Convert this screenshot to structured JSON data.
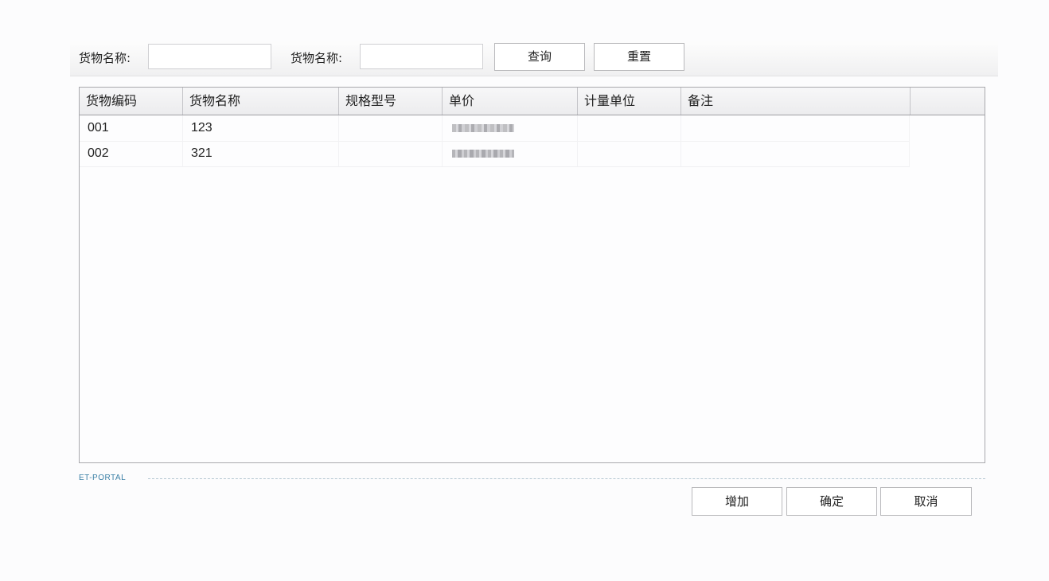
{
  "search": {
    "label1": "货物名称:",
    "label2": "货物名称:",
    "input1_value": "",
    "input2_value": "",
    "query_button": "查询",
    "reset_button": "重置"
  },
  "grid": {
    "columns": [
      "货物编码",
      "货物名称",
      "规格型号",
      "单价",
      "计量单位",
      "备注",
      ""
    ],
    "rows": [
      {
        "code": "001",
        "name": "123",
        "spec": "",
        "price": "",
        "unit": "",
        "note": ""
      },
      {
        "code": "002",
        "name": "321",
        "spec": "",
        "price": "",
        "unit": "",
        "note": ""
      }
    ]
  },
  "footer": {
    "brand": "ET-PORTAL",
    "add_button": "增加",
    "confirm_button": "确定",
    "cancel_button": "取消"
  }
}
